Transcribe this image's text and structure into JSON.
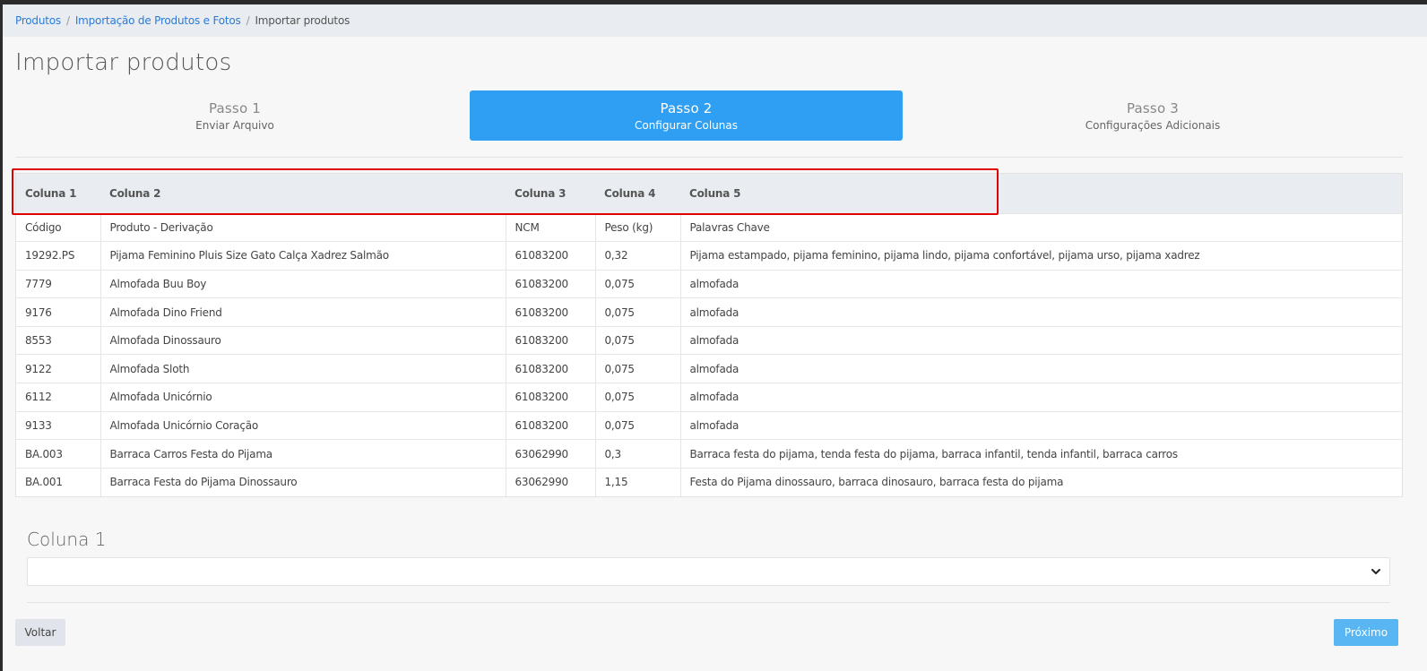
{
  "breadcrumb": {
    "items": [
      "Produtos",
      "Importação de Produtos e Fotos"
    ],
    "current": "Importar produtos"
  },
  "page": {
    "title": "Importar produtos"
  },
  "steps": [
    {
      "title": "Passo 1",
      "subtitle": "Enviar Arquivo",
      "active": false
    },
    {
      "title": "Passo 2",
      "subtitle": "Configurar Colunas",
      "active": true
    },
    {
      "title": "Passo 3",
      "subtitle": "Configurações Adicionais",
      "active": false
    }
  ],
  "table": {
    "headers": [
      "Coluna 1",
      "Coluna 2",
      "Coluna 3",
      "Coluna 4",
      "Coluna 5"
    ],
    "rows": [
      [
        "Código",
        "Produto - Derivação",
        "NCM",
        "Peso (kg)",
        "Palavras Chave"
      ],
      [
        "19292.PS",
        "Pijama Feminino Pluis Size Gato Calça Xadrez Salmão",
        "61083200",
        "0,32",
        "Pijama estampado, pijama feminino, pijama lindo, pijama confortável, pijama urso, pijama xadrez"
      ],
      [
        "7779",
        "Almofada Buu Boy",
        "61083200",
        "0,075",
        "almofada"
      ],
      [
        "9176",
        "Almofada Dino Friend",
        "61083200",
        "0,075",
        "almofada"
      ],
      [
        "8553",
        "Almofada Dinossauro",
        "61083200",
        "0,075",
        "almofada"
      ],
      [
        "9122",
        "Almofada Sloth",
        "61083200",
        "0,075",
        "almofada"
      ],
      [
        "6112",
        "Almofada Unicórnio",
        "61083200",
        "0,075",
        "almofada"
      ],
      [
        "9133",
        "Almofada Unicórnio Coração",
        "61083200",
        "0,075",
        "almofada"
      ],
      [
        "BA.003",
        "Barraca Carros Festa do Pijama",
        "63062990",
        "0,3",
        "Barraca festa do pijama, tenda festa do pijama, barraca infantil, tenda infantil, barraca carros"
      ],
      [
        "BA.001",
        "Barraca Festa do Pijama Dinossauro",
        "63062990",
        "1,15",
        "Festa do Pijama dinossauro, barraca dinosauro, barraca festa do pijama"
      ]
    ]
  },
  "column_config": {
    "title": "Coluna 1",
    "select_value": ""
  },
  "buttons": {
    "back": "Voltar",
    "next": "Próximo"
  },
  "colors": {
    "accent": "#2e9ff2",
    "link": "#2a7bd8",
    "highlight": "#e00000"
  }
}
